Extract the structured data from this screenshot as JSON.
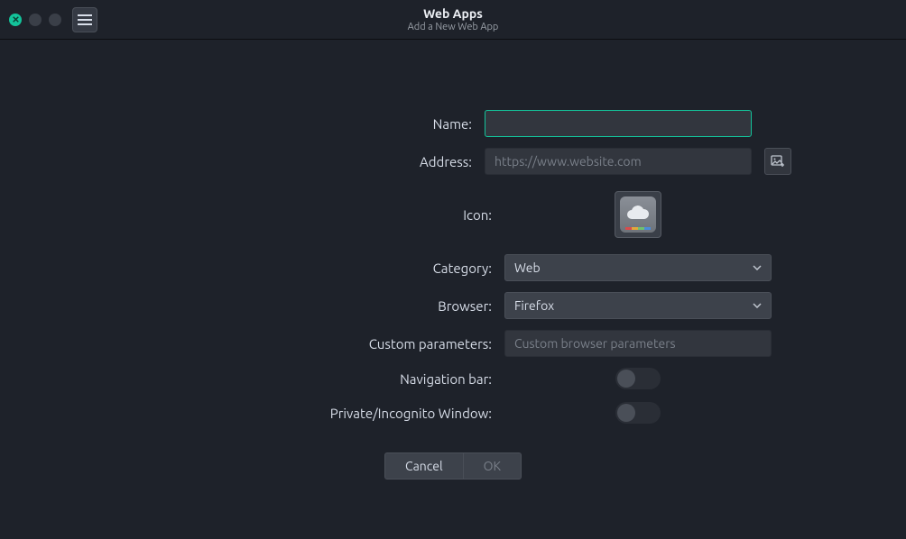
{
  "titlebar": {
    "title": "Web Apps",
    "subtitle": "Add a New Web App"
  },
  "form": {
    "name_label": "Name:",
    "name_value": "",
    "address_label": "Address:",
    "address_placeholder": "https://www.website.com",
    "address_value": "",
    "icon_label": "Icon:",
    "category_label": "Category:",
    "category_value": "Web",
    "browser_label": "Browser:",
    "browser_value": "Firefox",
    "custom_params_label": "Custom parameters:",
    "custom_params_placeholder": "Custom browser parameters",
    "custom_params_value": "",
    "nav_bar_label": "Navigation bar:",
    "nav_bar_on": false,
    "private_label": "Private/Incognito Window:",
    "private_on": false
  },
  "buttons": {
    "cancel": "Cancel",
    "ok": "OK"
  }
}
